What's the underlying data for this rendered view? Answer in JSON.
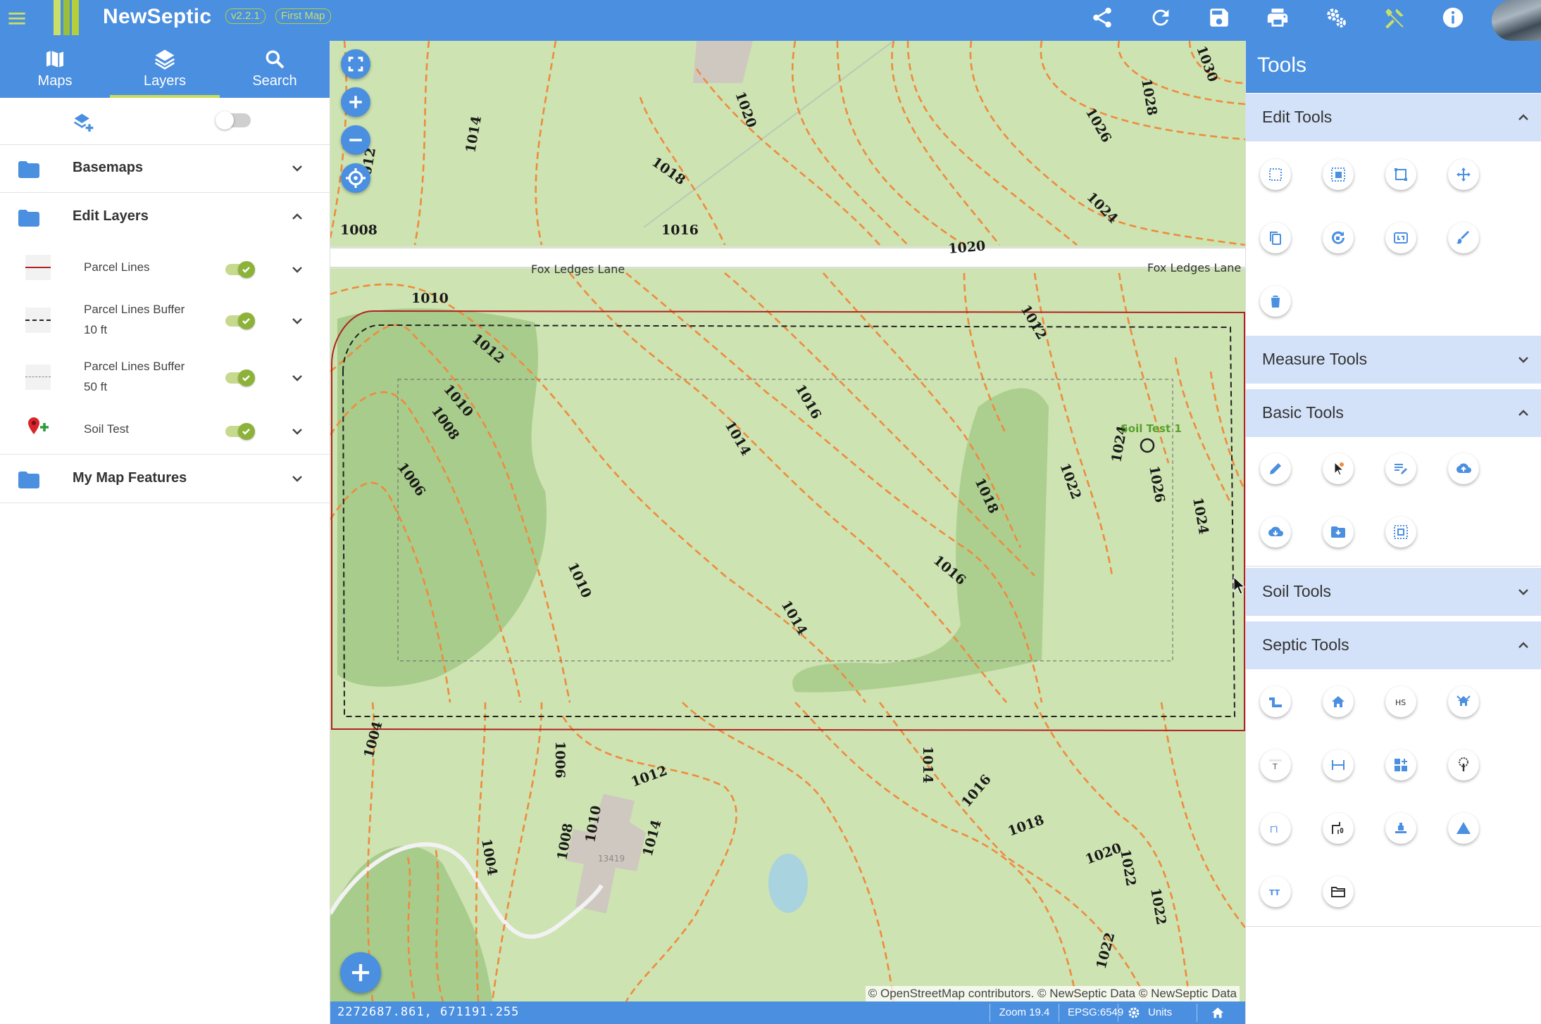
{
  "app": {
    "title": "NewSeptic",
    "version": "v2.2.1",
    "map_name": "First Map"
  },
  "topbar": {
    "icons": [
      "share-icon",
      "refresh-icon",
      "save-icon",
      "print-icon",
      "settings-icon",
      "tools-icon",
      "info-icon"
    ]
  },
  "nav": {
    "tabs": [
      {
        "label": "Maps",
        "icon": "map-icon"
      },
      {
        "label": "Layers",
        "icon": "layers-icon",
        "active": true
      },
      {
        "label": "Search",
        "icon": "search-icon"
      }
    ]
  },
  "layers": {
    "groups": [
      {
        "title": "Basemaps",
        "expanded": false
      },
      {
        "title": "Edit Layers",
        "expanded": true,
        "items": [
          {
            "label": "Parcel Lines",
            "visible": true
          },
          {
            "label": "Parcel Lines Buffer 10 ft",
            "line1": "Parcel Lines Buffer",
            "line2": "10 ft",
            "visible": true
          },
          {
            "label": "Parcel Lines Buffer 50 ft",
            "line1": "Parcel Lines Buffer",
            "line2": "50 ft",
            "visible": true
          },
          {
            "label": "Soil Test",
            "visible": true
          }
        ]
      },
      {
        "title": "My Map Features",
        "expanded": false
      }
    ]
  },
  "map": {
    "road_label_left": "Fox Ledges Lane",
    "road_label_right": "Fox Ledges Lane",
    "feature_label": "Soil Test 1",
    "house_number": "13419",
    "contour_labels": [
      "1008",
      "1010",
      "1010",
      "1012",
      "1012",
      "1014",
      "1014",
      "1016",
      "1016",
      "1016",
      "1018",
      "1018",
      "1020",
      "1020",
      "1022",
      "1022",
      "1024",
      "1024",
      "1026",
      "1026",
      "1028",
      "1030",
      "1004",
      "1004",
      "1006",
      "1006",
      "1008",
      "1008",
      "1010",
      "1010",
      "1012",
      "1014",
      "1014",
      "1016",
      "1018",
      "1020",
      "1022",
      "1024",
      "1012",
      "1014",
      "1022"
    ],
    "attribution": "© OpenStreetMap contributors. © NewSeptic Data © NewSeptic Data"
  },
  "status": {
    "coords": "2272687.861, 671191.255",
    "zoom": "Zoom 19.4",
    "epsg": "EPSG:6549",
    "units": "Units"
  },
  "tools": {
    "title": "Tools",
    "sections": [
      {
        "title": "Edit Tools",
        "expanded": true
      },
      {
        "title": "Measure Tools",
        "expanded": false
      },
      {
        "title": "Basic Tools",
        "expanded": true
      },
      {
        "title": "Soil Tools",
        "expanded": false
      },
      {
        "title": "Septic Tools",
        "expanded": true
      }
    ],
    "septic_glyphs": [
      "HS",
      "T",
      "ΓΊ",
      "TT"
    ]
  },
  "colors": {
    "primary": "#4a8fe0",
    "accent": "#c8dc5a",
    "contour": "#f08a3c",
    "parcel": "#b22222",
    "map_bg": "#cde3b1",
    "wood": "#a8cc8c"
  }
}
